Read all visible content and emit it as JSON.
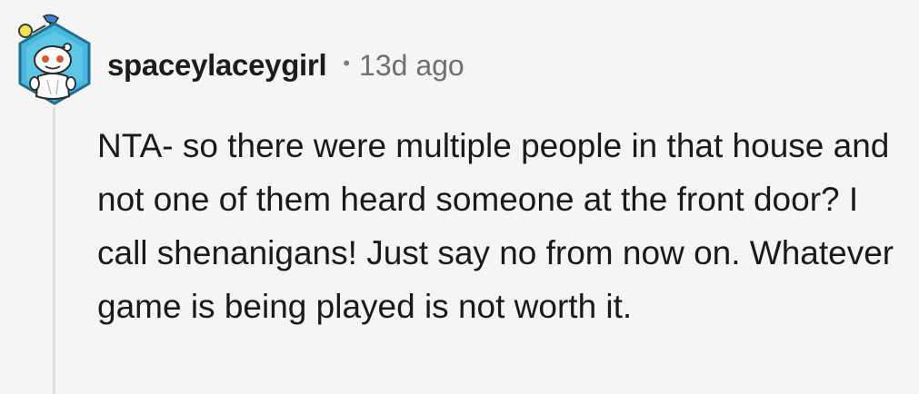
{
  "comment": {
    "author": "spaceylaceygirl",
    "separator": "•",
    "age": "13d ago",
    "body": "NTA- so there were multiple people in that house and not one of them heard someone at the front door? I call shenanigans! Just say no from now on. Whatever game is being played is not worth it.",
    "avatar_icon": "snoo-avatar-icon"
  },
  "colors": {
    "background": "#f7f5f3",
    "text": "#1c1c1c",
    "meta": "#6f6f6f",
    "avatar_hex": "#46b8dd",
    "avatar_bulb": "#f4e34a"
  }
}
